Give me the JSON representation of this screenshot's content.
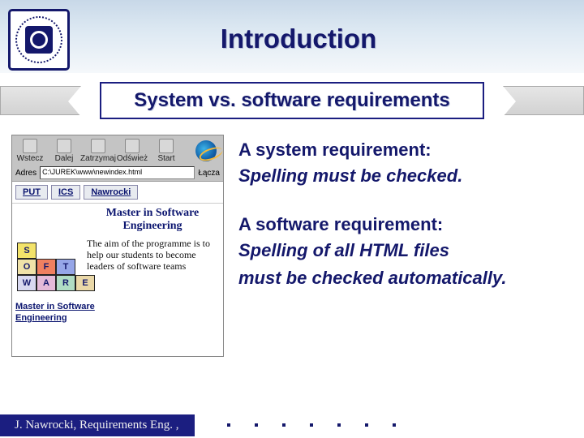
{
  "title": "Introduction",
  "subtitle": "System vs. software requirements",
  "system_req": {
    "heading": "A system requirement:",
    "body": "Spelling must be checked."
  },
  "software_req": {
    "heading": "A software requirement:",
    "body1": "Spelling of all HTML files",
    "body2": "must be checked automatically."
  },
  "browser": {
    "toolbar": {
      "b1": "Wstecz",
      "b2": "Dalej",
      "b3": "Zatrzymaj",
      "b4": "Odśwież",
      "b5": "Start"
    },
    "addr_label": "Adres",
    "addr_value": "C:\\JUREK\\www\\newindex.html",
    "go_label": "Łącza",
    "tabs": {
      "t1": "PUT",
      "t2": "ICS",
      "t3": "Nawrocki"
    },
    "blocks": {
      "s": "S",
      "o": "O",
      "f": "F",
      "t": "T",
      "w": "W",
      "a": "A",
      "r": "R",
      "e": "E"
    },
    "blocks_caption1": "Master in Software",
    "blocks_caption2": "Engineering",
    "mse_heading": "Master in Software Engineering",
    "mse_para": "The aim of the programme is to help our students to become leaders of software teams"
  },
  "footer": "J. Nawrocki, Requirements Eng. ,"
}
